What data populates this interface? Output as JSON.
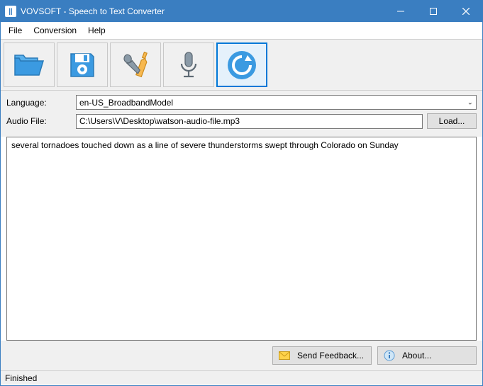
{
  "window": {
    "title": "VOVSOFT - Speech to Text Converter"
  },
  "menu": {
    "file": "File",
    "conversion": "Conversion",
    "help": "Help"
  },
  "toolbar": {
    "open": "Open",
    "save": "Save",
    "settings": "Settings",
    "record": "Record",
    "convert": "Convert"
  },
  "form": {
    "language_label": "Language:",
    "language_value": "en-US_BroadbandModel",
    "audio_label": "Audio File:",
    "audio_value": "C:\\Users\\V\\Desktop\\watson-audio-file.mp3",
    "load_button": "Load..."
  },
  "output": {
    "text": "several tornadoes touched down as a line of severe thunderstorms swept through Colorado on Sunday"
  },
  "footer": {
    "feedback": "Send Feedback...",
    "about": "About..."
  },
  "status": {
    "text": "Finished"
  }
}
